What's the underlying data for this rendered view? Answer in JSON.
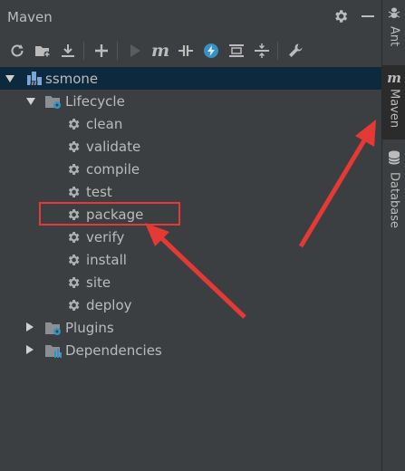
{
  "window": {
    "title": "Maven"
  },
  "toolbar": {
    "buttons": [
      "reload-icon",
      "add-folder-icon",
      "download-icon",
      "plus-icon",
      "run-icon",
      "maven-m-icon",
      "toggle-offline-icon",
      "lightning-icon",
      "collapse-icon",
      "expand-icon",
      "wrench-icon"
    ],
    "maven_glyph": "m"
  },
  "tree": {
    "project": "ssmone",
    "lifecycle": {
      "label": "Lifecycle",
      "phases": [
        "clean",
        "validate",
        "compile",
        "test",
        "package",
        "verify",
        "install",
        "site",
        "deploy"
      ]
    },
    "plugins": "Plugins",
    "dependencies": "Dependencies"
  },
  "right_sidebar": {
    "tabs": [
      {
        "label": "Ant",
        "icon": "ant-icon"
      },
      {
        "label": "Maven",
        "icon": "maven-m-icon",
        "glyph": "m",
        "active": true
      },
      {
        "label": "Database",
        "icon": "database-icon"
      }
    ]
  },
  "colors": {
    "background": "#3c3f41",
    "selected_row": "#0d293e",
    "annotation": "#e53935"
  }
}
